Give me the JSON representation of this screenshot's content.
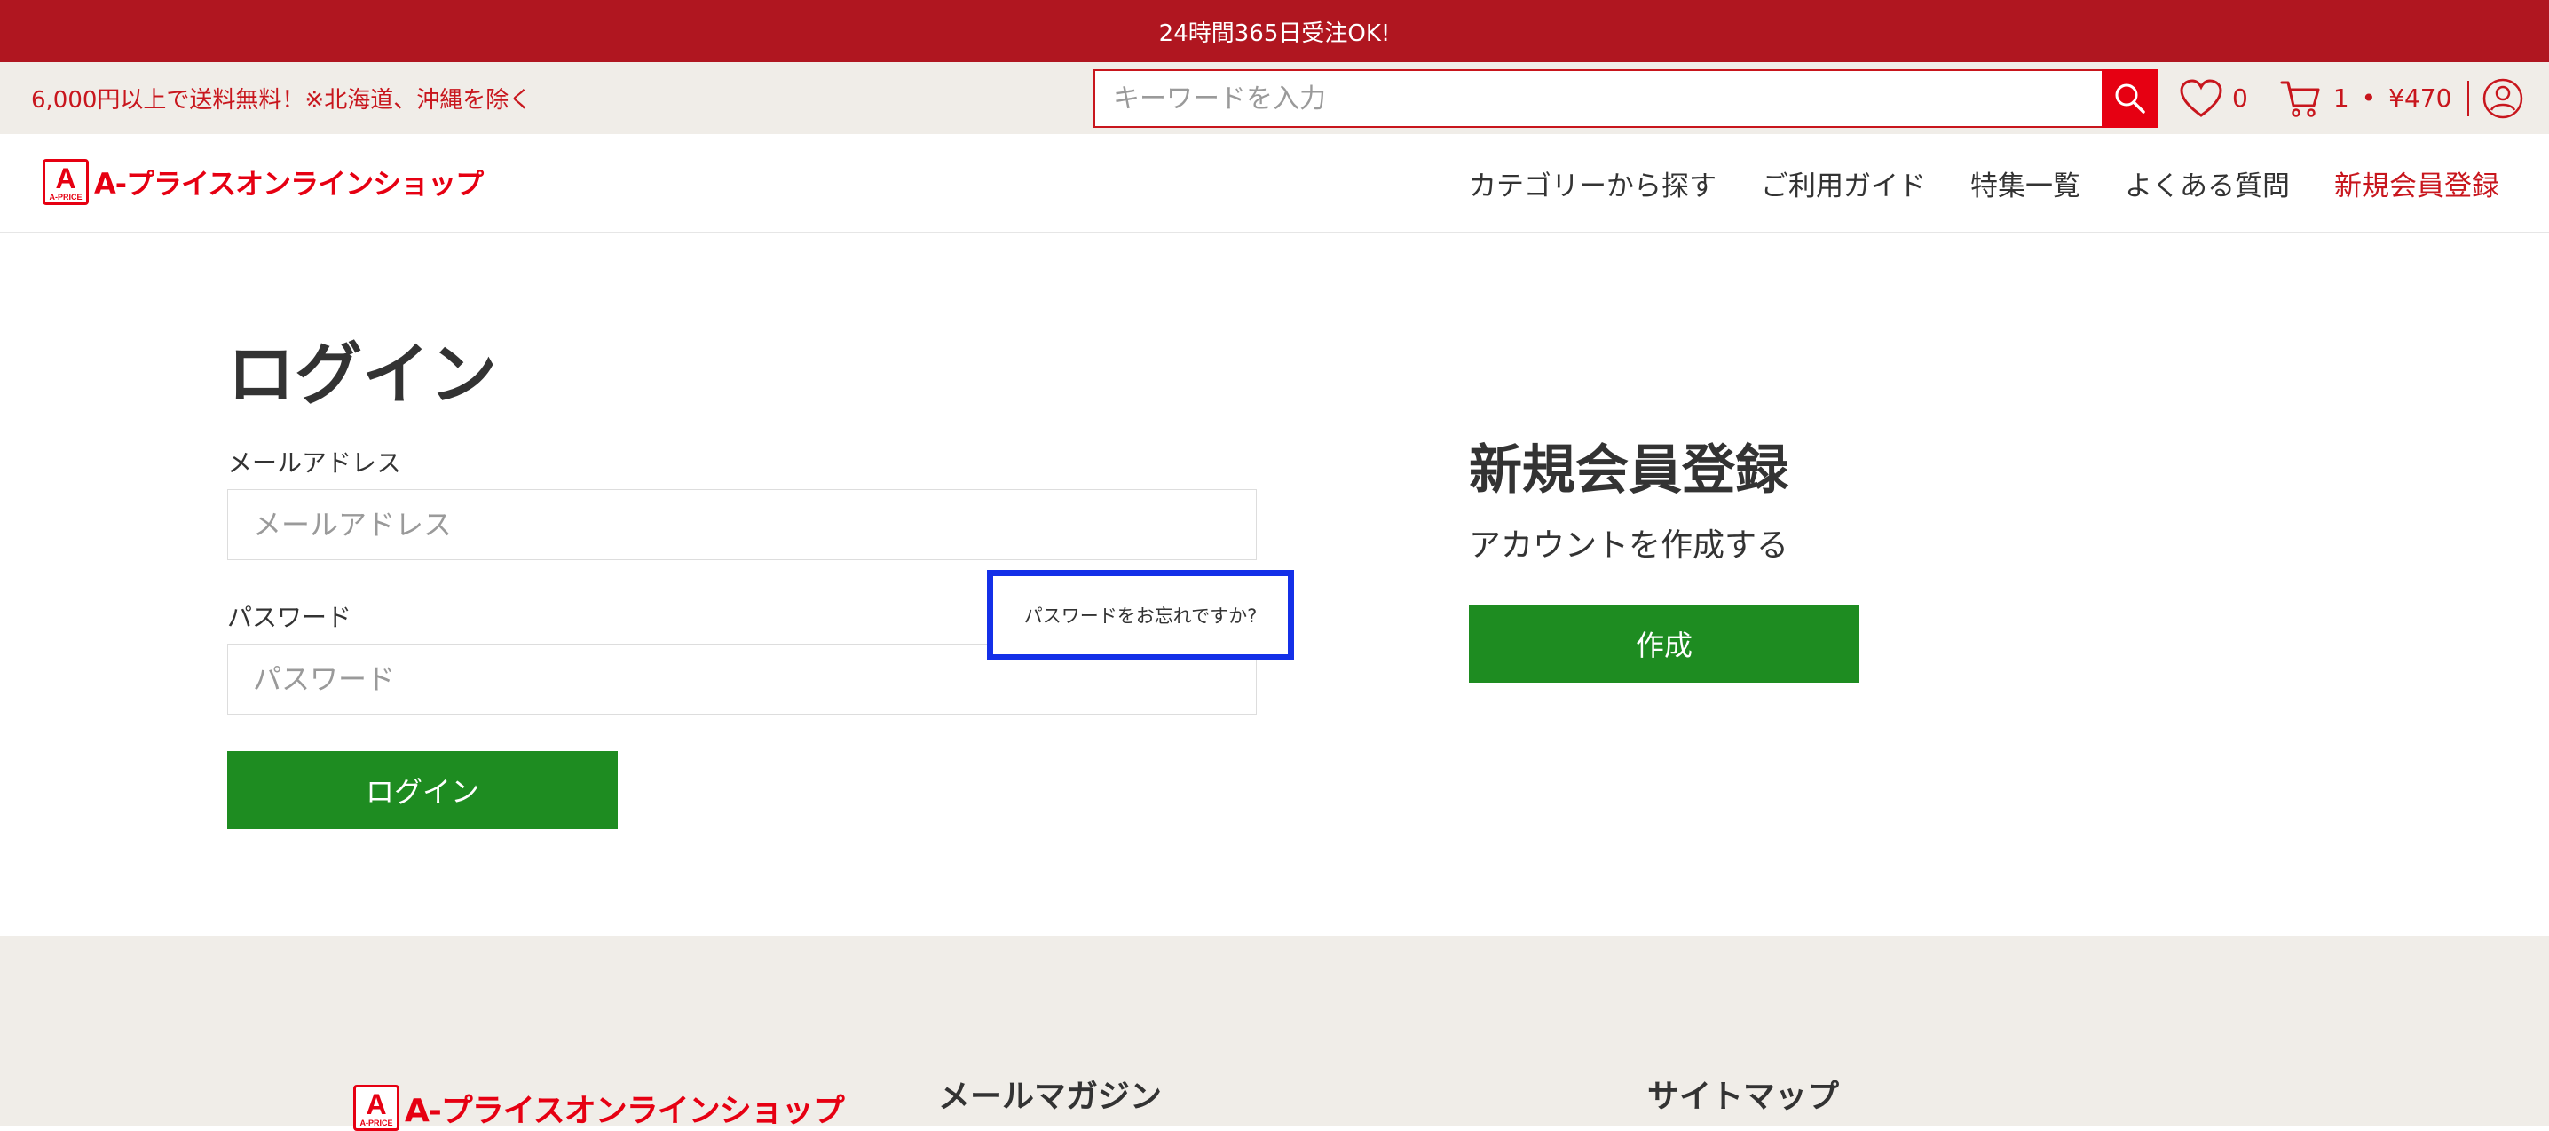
{
  "banner": {
    "text": "24時間365日受注OK!"
  },
  "util_bar": {
    "shipping_note": "6,000円以上で送料無料！※北海道、沖縄を除く",
    "search_placeholder": "キーワードを入力",
    "favorites_count": "0",
    "cart_count": "1",
    "cart_separator": "•",
    "cart_total": "¥470"
  },
  "header": {
    "logo_mark_letter": "A",
    "logo_mark_sub": "A-PRICE",
    "logo_text": "A-プライスオンラインショップ",
    "nav": [
      {
        "label": "カテゴリーから探す"
      },
      {
        "label": "ご利用ガイド"
      },
      {
        "label": "特集一覧"
      },
      {
        "label": "よくある質問"
      },
      {
        "label": "新規会員登録"
      }
    ]
  },
  "login": {
    "title": "ログイン",
    "email_label": "メールアドレス",
    "email_placeholder": "メールアドレス",
    "password_label": "パスワード",
    "password_placeholder": "パスワード",
    "forgot_link": "パスワードをお忘れですか?",
    "submit_label": "ログイン"
  },
  "register": {
    "title": "新規会員登録",
    "subtitle": "アカウントを作成する",
    "button_label": "作成"
  },
  "footer": {
    "logo_text": "A-プライスオンラインショップ",
    "newsletter_heading": "メールマガジン",
    "sitemap_heading": "サイトマップ"
  },
  "colors": {
    "brand_red": "#e60012",
    "banner_red": "#b01620",
    "accent_green": "#1e8c21",
    "highlight_blue": "#1430e8",
    "utility_bg": "#f0ede8"
  }
}
